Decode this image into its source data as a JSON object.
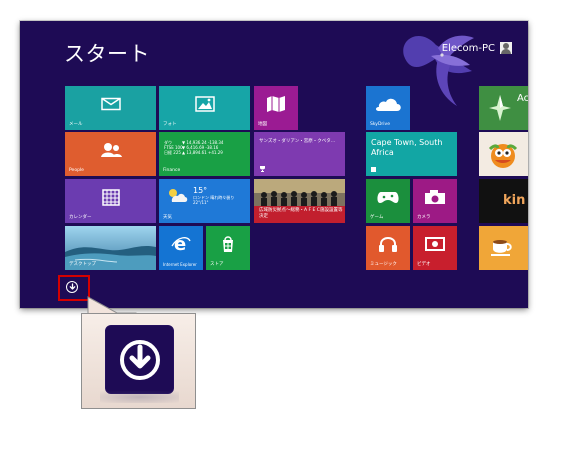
{
  "screen": {
    "title": "スタート",
    "user_name": "Elecom-PC"
  },
  "tiles": [
    {
      "name": "mail",
      "label": "メール",
      "color": "#1aa1a2",
      "icon": "mail-icon"
    },
    {
      "name": "photos",
      "label": "フォト",
      "color": "#17a5a7",
      "icon": "photos-icon"
    },
    {
      "name": "maps",
      "label": "地図",
      "color": "#9b1b93",
      "icon": "maps-icon"
    },
    {
      "name": "people",
      "label": "People",
      "color": "#df5d2f",
      "icon": "people-icon"
    },
    {
      "name": "finance",
      "label": "Finance",
      "color": "#19a045",
      "lines": "ダウ\nFTSE 100\n日経 225",
      "values": "▼ 14,936.24 -138.34\n▼ 6,416.69 -38.16\n▲ 13,894.61 +41.29"
    },
    {
      "name": "news",
      "label": "",
      "color": "#7e3ab0",
      "headline": "サンズオ・ダリアン・宮原・クベタ…"
    },
    {
      "name": "calendar",
      "label": "カレンダー",
      "color": "#6b3cb0",
      "icon": "calendar-icon"
    },
    {
      "name": "weather",
      "label": "天気",
      "color": "#1f79d7",
      "temp": "15°",
      "place": "ロンドン\n晴れ時々曇り\n22°/11°"
    },
    {
      "name": "photo-news",
      "label": "",
      "color": "#c21f2e",
      "headline": "広域防災拠点～総務・A F E C施設設置等決定"
    },
    {
      "name": "desktop",
      "label": "デスクトップ",
      "color": "#6aa7c9"
    },
    {
      "name": "internet-explorer",
      "label": "Internet Explorer",
      "color": "#1474d3",
      "icon": "ie-icon"
    },
    {
      "name": "store",
      "label": "ストア",
      "color": "#19a045",
      "icon": "store-icon"
    },
    {
      "name": "skydrive",
      "label": "SkyDrive",
      "color": "#1b74d1",
      "icon": "cloud-icon"
    },
    {
      "name": "travel",
      "label": "",
      "color": "#12a6a4",
      "headline": "Cape Town, South Africa"
    },
    {
      "name": "games",
      "label": "ゲーム",
      "color": "#1b8f3d",
      "icon": "controller-icon"
    },
    {
      "name": "camera",
      "label": "カメラ",
      "color": "#9d1a85",
      "icon": "camera-icon"
    },
    {
      "name": "music",
      "label": "ミュージック",
      "color": "#e1592d",
      "icon": "headphones-icon"
    },
    {
      "name": "video",
      "label": "ビデオ",
      "color": "#c81f2d",
      "icon": "video-icon"
    },
    {
      "name": "partial-app-a",
      "label": "",
      "color": "#3f8f42",
      "text": "Ac"
    },
    {
      "name": "partial-app-b",
      "label": "",
      "color": "#f3ebe2"
    },
    {
      "name": "partial-app-c",
      "label": "",
      "color": "#111111",
      "text": "kin"
    },
    {
      "name": "partial-app-d",
      "label": "",
      "color": "#f0a638"
    }
  ],
  "annotation": {
    "marker_icon": "download-icon",
    "highlight_color": "#d40000"
  }
}
